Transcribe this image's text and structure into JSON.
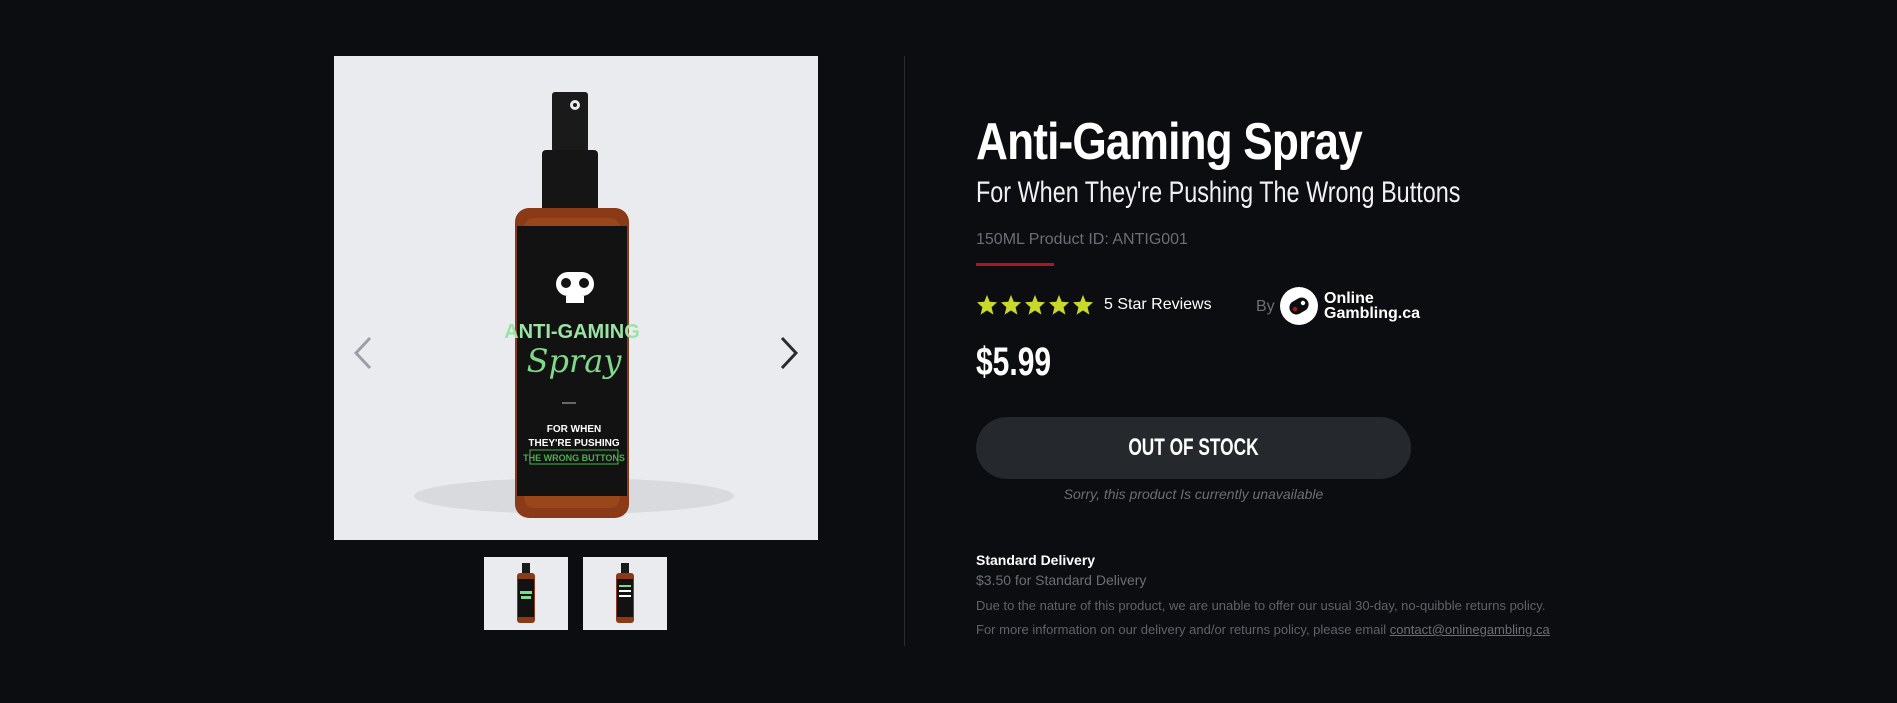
{
  "product": {
    "title": "Anti-Gaming Spray",
    "subtitle": "For When They're Pushing The Wrong Buttons",
    "product_id": "150ML Product ID: ANTIG001",
    "rating_stars": 5,
    "reviews_label": "5 Star Reviews",
    "by_label": "By",
    "brand_line1": "Online",
    "brand_line2": "Gambling.ca",
    "price": "$5.99",
    "stock_button": "OUT OF STOCK",
    "unavailable_note": "Sorry, this product Is currently unavailable"
  },
  "bottle_label": {
    "line1": "ANTI-GAMING",
    "line2": "Spray",
    "line3": "FOR WHEN",
    "line4": "THEY'RE PUSHING",
    "line5": "THE WRONG BUTTONS"
  },
  "delivery": {
    "title": "Standard Delivery",
    "price_text": "$3.50 for Standard Delivery",
    "policy_text": "Due to the nature of this product, we are unable to offer our usual 30-day, no-quibble returns policy.",
    "contact_prefix": "For more information on our delivery and/or returns policy, please email ",
    "contact_email": "contact@onlinegambling.ca"
  },
  "colors": {
    "background": "#0c0d10",
    "accent_red": "#b5121b",
    "star_yellow": "#c9d82b",
    "button_bg": "#25282d",
    "label_green": "#7fd98a"
  },
  "icons": {
    "prev": "chevron-left-icon",
    "next": "chevron-right-icon",
    "star": "star-icon",
    "brand": "gamepad-logo-icon"
  }
}
